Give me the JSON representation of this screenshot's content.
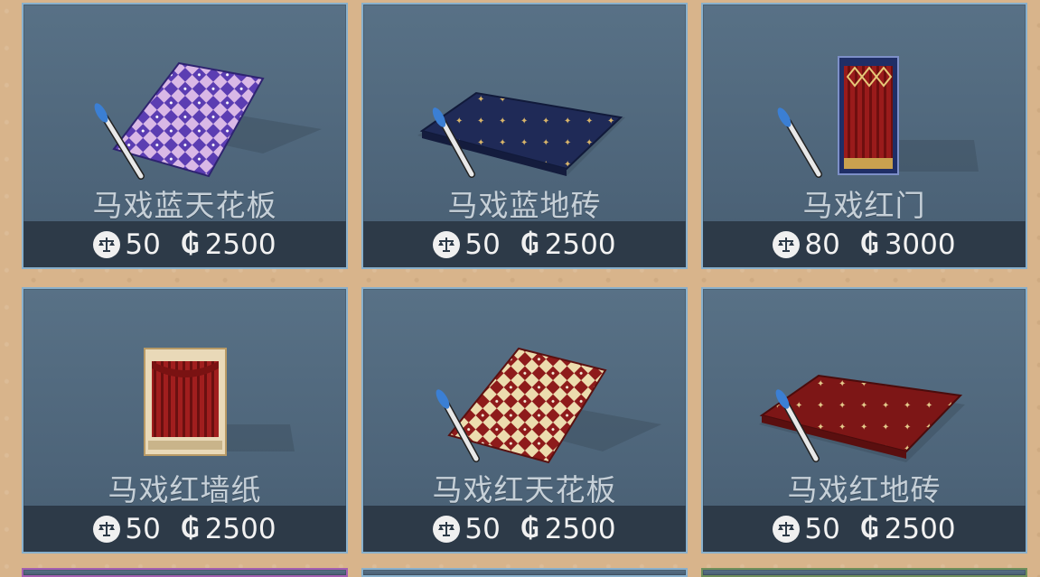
{
  "items": [
    {
      "name": "马戏蓝天花板",
      "tokens": "50",
      "gold": "2500"
    },
    {
      "name": "马戏蓝地砖",
      "tokens": "50",
      "gold": "2500"
    },
    {
      "name": "马戏红门",
      "tokens": "80",
      "gold": "3000"
    },
    {
      "name": "马戏红墙纸",
      "tokens": "50",
      "gold": "2500"
    },
    {
      "name": "马戏红天花板",
      "tokens": "50",
      "gold": "2500"
    },
    {
      "name": "马戏红地砖",
      "tokens": "50",
      "gold": "2500"
    }
  ],
  "icons": {
    "token": "balance-scale-icon",
    "gold": "gold-g-icon",
    "brush": "paintbrush-icon"
  },
  "colors": {
    "card_bg": "#587186",
    "card_border": "#89b0cc",
    "price_bar": "#2d3a48",
    "blue_pattern": "#5a3fb0",
    "red_pattern": "#8b1a1a"
  }
}
